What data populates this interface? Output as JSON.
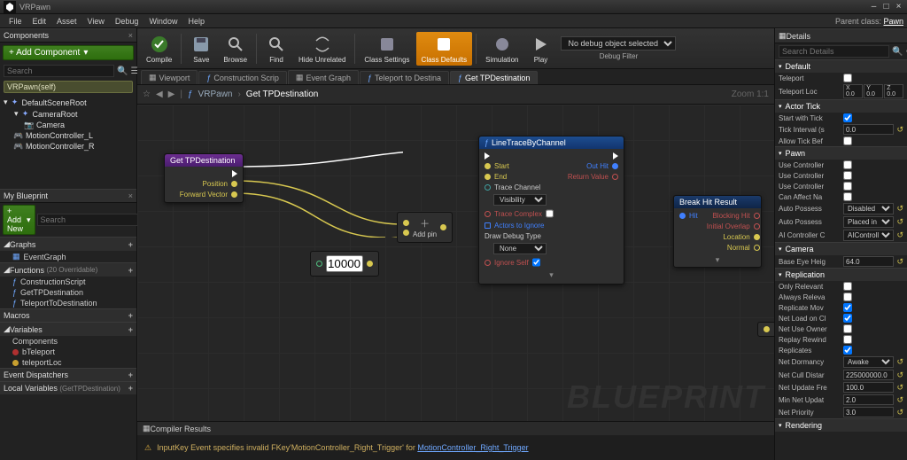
{
  "titlebar": {
    "title": "VRPawn"
  },
  "menu": [
    "File",
    "Edit",
    "Asset",
    "View",
    "Debug",
    "Window",
    "Help"
  ],
  "parentClass": {
    "label": "Parent class:",
    "value": "Pawn"
  },
  "leftPanels": {
    "components": {
      "title": "Components",
      "addLabel": "+ Add Component",
      "searchPlaceholder": "Search",
      "selfTag": "VRPawn(self)",
      "tree": [
        {
          "name": "DefaultSceneRoot",
          "indent": 0
        },
        {
          "name": "CameraRoot",
          "indent": 1
        },
        {
          "name": "Camera",
          "indent": 2
        },
        {
          "name": "MotionController_L",
          "indent": 1
        },
        {
          "name": "MotionController_R",
          "indent": 1
        }
      ]
    },
    "myBlueprint": {
      "title": "My Blueprint",
      "addLabel": "+ Add New",
      "searchPlaceholder": "Search",
      "sections": {
        "graphs": {
          "title": "Graphs",
          "items": [
            "EventGraph"
          ]
        },
        "functions": {
          "title": "Functions",
          "note": "(20 Overridable)",
          "items": [
            "ConstructionScript",
            "GetTPDestination",
            "TeleportToDestination"
          ]
        },
        "macros": {
          "title": "Macros",
          "items": []
        },
        "variables": {
          "title": "Variables",
          "groups": [
            {
              "name": "Components",
              "items": []
            },
            {
              "name": "bTeleport",
              "color": "red"
            },
            {
              "name": "teleportLoc",
              "color": "yellow"
            }
          ]
        },
        "eventDispatchers": {
          "title": "Event Dispatchers"
        },
        "localVars": {
          "title": "Local Variables",
          "note": "(GetTPDestination)"
        }
      }
    }
  },
  "toolbar": {
    "buttons": [
      {
        "id": "compile",
        "label": "Compile"
      },
      {
        "id": "save",
        "label": "Save"
      },
      {
        "id": "browse",
        "label": "Browse"
      },
      {
        "id": "find",
        "label": "Find"
      },
      {
        "id": "hide",
        "label": "Hide Unrelated"
      },
      {
        "id": "classsettings",
        "label": "Class Settings"
      },
      {
        "id": "classdefaults",
        "label": "Class Defaults",
        "active": true
      },
      {
        "id": "simulation",
        "label": "Simulation"
      },
      {
        "id": "play",
        "label": "Play"
      }
    ],
    "debugSelect": "No debug object selected",
    "debugFilter": "Debug Filter"
  },
  "subtabs": [
    "Viewport",
    "Construction Scrip",
    "Event Graph",
    "Teleport to Destina",
    "Get TPDestination"
  ],
  "activeSubtab": 4,
  "breadcrumb": {
    "fn": "VRPawn",
    "cur": "Get TPDestination",
    "zoom": "Zoom 1:1"
  },
  "nodes": {
    "getTP": {
      "title": "Get TPDestination",
      "outs": [
        "",
        "Position",
        "Forward Vector"
      ]
    },
    "mult": {
      "label": "Add pin",
      "plus": "+"
    },
    "literal": {
      "value": "10000.0"
    },
    "lineTrace": {
      "title": "LineTraceByChannel",
      "ins": [
        "",
        "Start",
        "End"
      ],
      "traceChannel": {
        "label": "Trace Channel",
        "value": "Visibility"
      },
      "traceComplex": "Trace Complex",
      "actorsIgnore": "Actors to Ignore",
      "drawDebug": {
        "label": "Draw Debug Type",
        "value": "None"
      },
      "ignoreSelf": "Ignore Self",
      "outs": [
        "",
        "Out Hit",
        "Return Value"
      ]
    },
    "breakHit": {
      "title": "Break Hit Result",
      "in": "Hit",
      "outs": [
        "Blocking Hit",
        "Initial Overlap",
        "Location",
        "Normal"
      ]
    }
  },
  "compiler": {
    "title": "Compiler Results",
    "msgPrefix": "InputKey Event specifies invalid FKey'MotionController_Right_Trigger' for",
    "link": "MotionController_Right_Trigger"
  },
  "details": {
    "title": "Details",
    "searchPlaceholder": "Search Details",
    "sections": [
      {
        "title": "Default",
        "rows": [
          {
            "label": "Teleport",
            "type": "check",
            "value": false
          },
          {
            "label": "Teleport Loc",
            "type": "xyz",
            "x": "0.0",
            "y": "0.0",
            "z": "0.0"
          }
        ]
      },
      {
        "title": "Actor Tick",
        "rows": [
          {
            "label": "Start with Tick",
            "type": "check",
            "value": true
          },
          {
            "label": "Tick Interval (s",
            "type": "text",
            "value": "0.0"
          },
          {
            "label": "Allow Tick Bef",
            "type": "check",
            "value": false
          }
        ]
      },
      {
        "title": "Pawn",
        "rows": [
          {
            "label": "Use Controller",
            "type": "check",
            "value": false
          },
          {
            "label": "Use Controller",
            "type": "check",
            "value": false
          },
          {
            "label": "Use Controller",
            "type": "check",
            "value": false
          },
          {
            "label": "Can Affect Na",
            "type": "check",
            "value": false
          },
          {
            "label": "Auto Possess",
            "type": "select",
            "value": "Disabled"
          },
          {
            "label": "Auto Possess",
            "type": "select",
            "value": "Placed in World"
          },
          {
            "label": "AI Controller C",
            "type": "select",
            "value": "AIControll"
          }
        ]
      },
      {
        "title": "Camera",
        "rows": [
          {
            "label": "Base Eye Heig",
            "type": "text",
            "value": "64.0"
          }
        ]
      },
      {
        "title": "Replication",
        "rows": [
          {
            "label": "Only Relevant",
            "type": "check",
            "value": false
          },
          {
            "label": "Always Releva",
            "type": "check",
            "value": false
          },
          {
            "label": "Replicate Mov",
            "type": "check",
            "value": true
          },
          {
            "label": "Net Load on Cl",
            "type": "check",
            "value": true
          },
          {
            "label": "Net Use Owner",
            "type": "check",
            "value": false
          },
          {
            "label": "Replay Rewind",
            "type": "check",
            "value": false
          },
          {
            "label": "Replicates",
            "type": "check",
            "value": true
          },
          {
            "label": "Net Dormancy",
            "type": "select",
            "value": "Awake"
          },
          {
            "label": "Net Cull Distar",
            "type": "text",
            "value": "225000000.0"
          },
          {
            "label": "Net Update Fre",
            "type": "text",
            "value": "100.0"
          },
          {
            "label": "Min Net Updat",
            "type": "text",
            "value": "2.0"
          },
          {
            "label": "Net Priority",
            "type": "text",
            "value": "3.0"
          }
        ]
      },
      {
        "title": "Rendering",
        "rows": []
      }
    ]
  }
}
